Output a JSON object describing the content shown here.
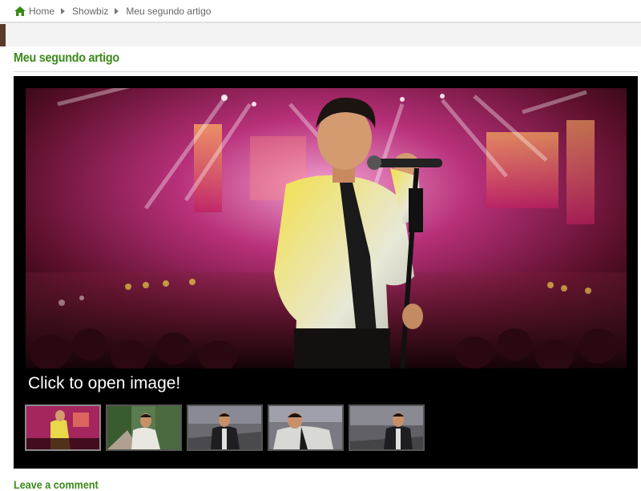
{
  "breadcrumb": {
    "items": [
      {
        "label": "Home",
        "icon": "home-icon"
      },
      {
        "label": "Showbiz"
      },
      {
        "label": "Meu segundo artigo"
      }
    ]
  },
  "article": {
    "title": "Meu segundo artigo"
  },
  "gallery": {
    "caption": "Click to open image!",
    "thumbnail_count": 5,
    "active_thumbnail": 1
  },
  "comments": {
    "heading": "Leave a comment"
  },
  "colors": {
    "accent_green": "#3a8a1a",
    "gallery_bg": "#000000"
  }
}
